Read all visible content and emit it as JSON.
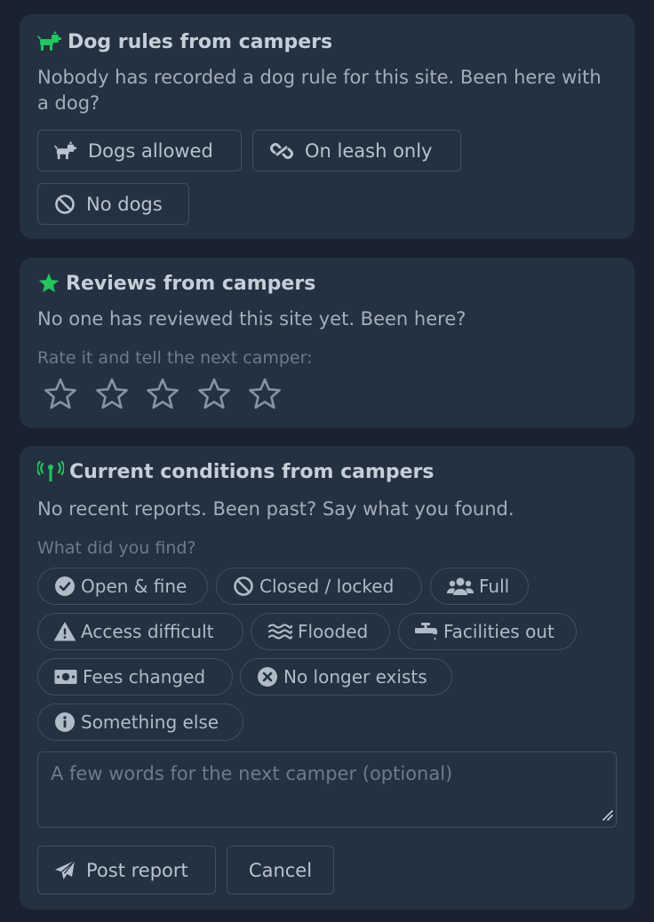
{
  "dogs": {
    "title": "Dog rules from campers",
    "body": "Nobody has recorded a dog rule for this site. Been here with a dog?",
    "icon": "dog-icon",
    "accent": "#22c55e",
    "options": [
      {
        "label": "Dogs allowed",
        "icon": "dog-icon"
      },
      {
        "label": "On leash only",
        "icon": "link-icon"
      },
      {
        "label": "No dogs",
        "icon": "ban-icon"
      }
    ]
  },
  "reviews": {
    "title": "Reviews from campers",
    "body": "No one has reviewed this site yet. Been here?",
    "prompt": "Rate it and tell the next camper:",
    "icon": "star-icon",
    "rating": 0,
    "max_rating": 5
  },
  "conditions": {
    "title": "Current conditions from campers",
    "body": "No recent reports. Been past? Say what you found.",
    "prompt": "What did you find?",
    "icon": "broadcast-tower-icon",
    "chips": [
      {
        "label": "Open & fine",
        "icon": "check-circle-icon"
      },
      {
        "label": "Closed / locked",
        "icon": "ban-icon"
      },
      {
        "label": "Full",
        "icon": "users-icon"
      },
      {
        "label": "Access difficult",
        "icon": "warning-icon"
      },
      {
        "label": "Flooded",
        "icon": "water-icon"
      },
      {
        "label": "Facilities out",
        "icon": "faucet-icon"
      },
      {
        "label": "Fees changed",
        "icon": "money-icon"
      },
      {
        "label": "No longer exists",
        "icon": "x-circle-icon"
      },
      {
        "label": "Something else",
        "icon": "info-circle-icon"
      }
    ],
    "note_placeholder": "A few words for the next camper (optional)",
    "note_value": "",
    "submit_label": "Post report",
    "cancel_label": "Cancel"
  },
  "colors": {
    "background": "#19222e",
    "card": "#233141",
    "border": "#3f5062",
    "accent": "#22c55e"
  }
}
